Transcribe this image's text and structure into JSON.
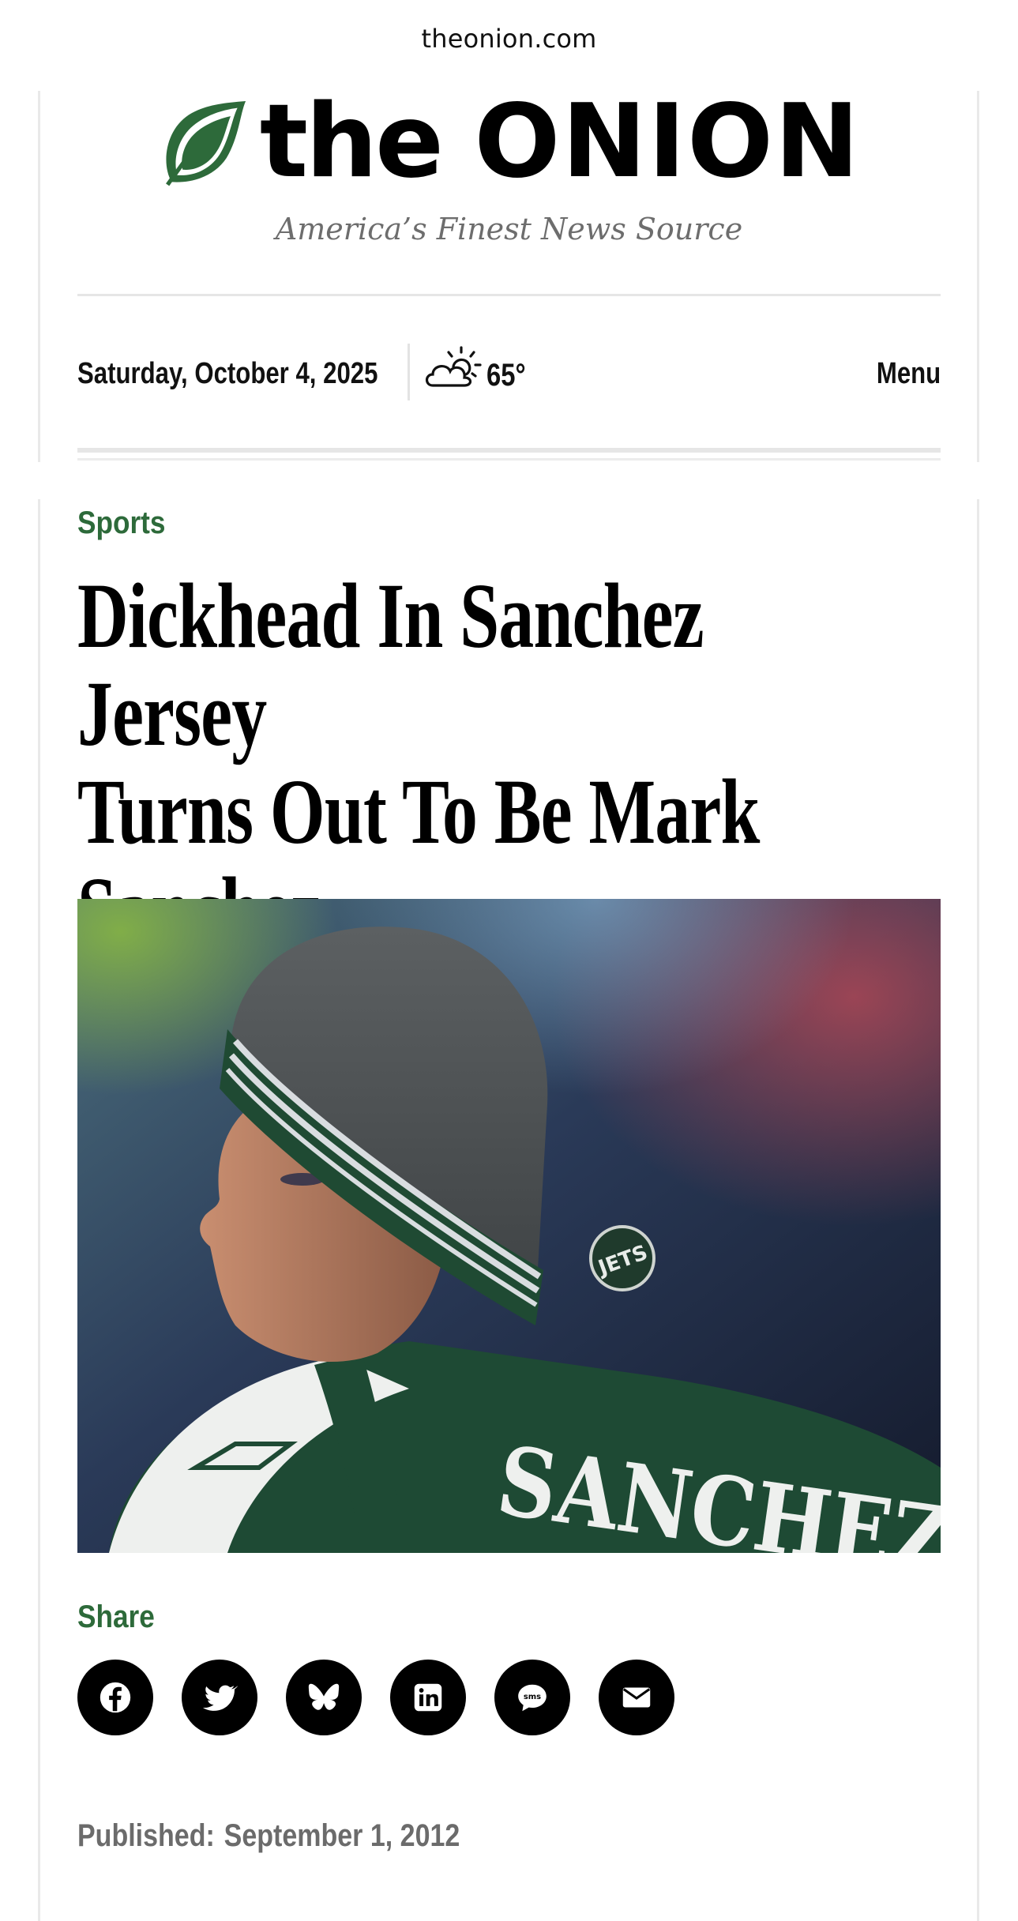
{
  "browser": {
    "url": "theonion.com"
  },
  "site": {
    "name_prefix": "the",
    "name_main": "ONION",
    "tagline": "America’s Finest News Source",
    "brand_green": "#2d6a3a"
  },
  "topbar": {
    "date": "Saturday, October 4, 2025",
    "temperature": "65°",
    "weather_icon": "partly-cloudy-icon",
    "menu_label": "Menu"
  },
  "article": {
    "category": "Sports",
    "headline_lines": [
      "Dickhead In Sanchez Jersey",
      "Turns Out To Be Mark",
      "Sanchez"
    ],
    "hero_image_jersey_text": "SANCHEZ",
    "hero_image_patch_text": "JETS",
    "share_label": "Share",
    "share_buttons": [
      {
        "name": "facebook",
        "icon": "facebook-icon"
      },
      {
        "name": "twitter",
        "icon": "twitter-icon"
      },
      {
        "name": "bluesky",
        "icon": "bluesky-icon"
      },
      {
        "name": "linkedin",
        "icon": "linkedin-icon"
      },
      {
        "name": "sms",
        "icon": "sms-icon",
        "icon_text": "sms"
      },
      {
        "name": "email",
        "icon": "email-icon"
      }
    ],
    "published_label": "Published:",
    "published_date": "September 1, 2012"
  }
}
